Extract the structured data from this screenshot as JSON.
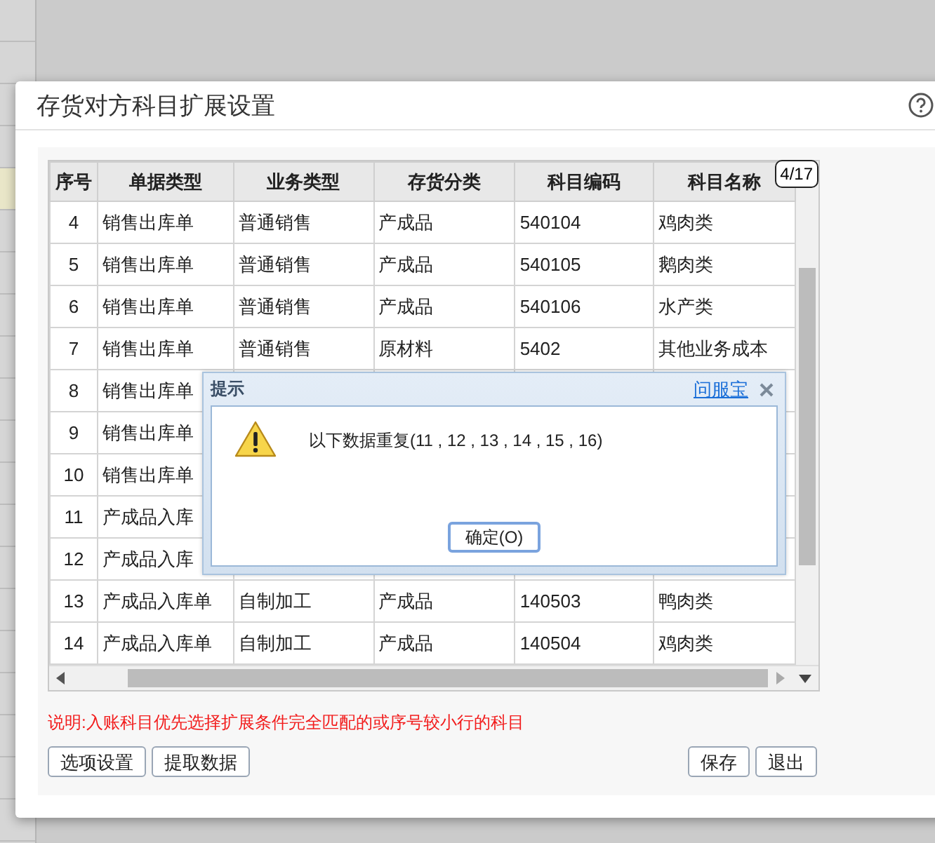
{
  "window": {
    "title": "存货对方科目扩展设置"
  },
  "table": {
    "columns": [
      "序号",
      "单据类型",
      "业务类型",
      "存货分类",
      "科目编码",
      "科目名称"
    ],
    "badge": "4/17",
    "rows": [
      {
        "cells": [
          "4",
          "销售出库单",
          "普通销售",
          "产成品",
          "540104",
          "鸡肉类"
        ]
      },
      {
        "cells": [
          "5",
          "销售出库单",
          "普通销售",
          "产成品",
          "540105",
          "鹅肉类"
        ]
      },
      {
        "cells": [
          "6",
          "销售出库单",
          "普通销售",
          "产成品",
          "540106",
          "水产类"
        ]
      },
      {
        "cells": [
          "7",
          "销售出库单",
          "普通销售",
          "原材料",
          "5402",
          "其他业务成本"
        ]
      },
      {
        "cells": [
          "8",
          "销售出库单"
        ]
      },
      {
        "cells": [
          "9",
          "销售出库单"
        ]
      },
      {
        "cells": [
          "10",
          "销售出库单"
        ]
      },
      {
        "cells": [
          "11",
          "产成品入库"
        ]
      },
      {
        "cells": [
          "12",
          "产成品入库"
        ]
      },
      {
        "cells": [
          "13",
          "产成品入库单",
          "自制加工",
          "产成品",
          "140503",
          "鸭肉类"
        ]
      },
      {
        "cells": [
          "14",
          "产成品入库单",
          "自制加工",
          "产成品",
          "140504",
          "鸡肉类"
        ]
      }
    ]
  },
  "note": "说明:入账科目优先选择扩展条件完全匹配的或序号较小行的科目",
  "buttons_left": [
    "选项设置",
    "提取数据"
  ],
  "buttons_right": [
    "保存",
    "退出"
  ],
  "alert": {
    "title": "提示",
    "link": "问服宝",
    "message": "以下数据重复(11 , 12 , 13 , 14 , 15 , 16)",
    "button": "确定(O)"
  }
}
